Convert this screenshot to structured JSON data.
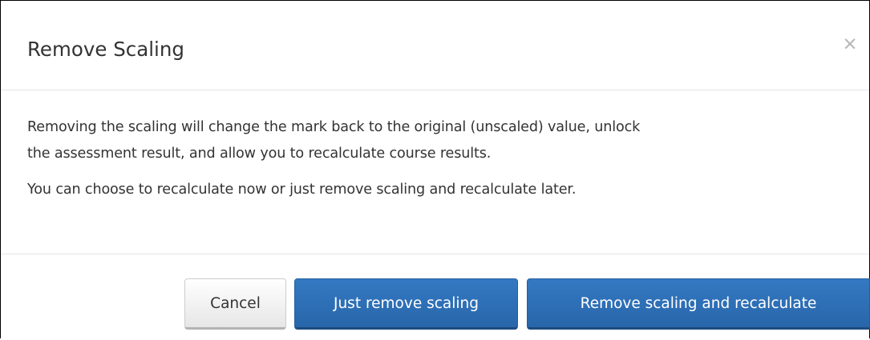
{
  "dialog": {
    "title": "Remove Scaling",
    "close_glyph": "×",
    "close_icon": "close-icon",
    "body": {
      "paragraph_1_line_1": "Removing the scaling will change the mark back to the original (unscaled) value, unlock",
      "paragraph_1_line_2": "the assessment result, and allow you to recalculate course results.",
      "paragraph_2": "You can choose to recalculate now or just remove scaling and recalculate later."
    },
    "footer": {
      "cancel_label": "Cancel",
      "just_remove_label": "Just remove scaling",
      "remove_and_recalculate_label": "Remove scaling and recalculate"
    }
  },
  "colors": {
    "primary": "#2d6fb6",
    "text": "#333333",
    "divider": "#e5e5e5",
    "close_icon": "#b4b4b4"
  }
}
